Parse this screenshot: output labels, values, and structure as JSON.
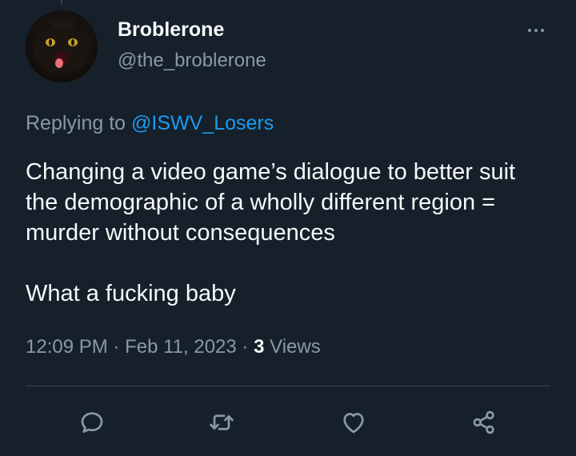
{
  "tweet": {
    "display_name": "Broblerone",
    "handle": "@the_broblerone",
    "replying_prefix": "Replying to",
    "replying_to": "@ISWV_Losers",
    "text_paragraph_1": "Changing a video game’s dialogue to better suit the demographic of a wholly different region = murder without consequences",
    "text_paragraph_2": "What a fucking baby",
    "time": "12:09 PM",
    "date": "Feb 11, 2023",
    "separator": "·",
    "views_count": "3",
    "views_label": "Views"
  },
  "actions": [
    {
      "icon": "reply-icon"
    },
    {
      "icon": "retweet-icon"
    },
    {
      "icon": "like-icon"
    },
    {
      "icon": "share-icon"
    }
  ],
  "colors": {
    "background": "#15202b",
    "text_primary": "#f7f9f9",
    "text_secondary": "#8b98a5",
    "link": "#1d9bf0",
    "divider": "#38444d"
  }
}
